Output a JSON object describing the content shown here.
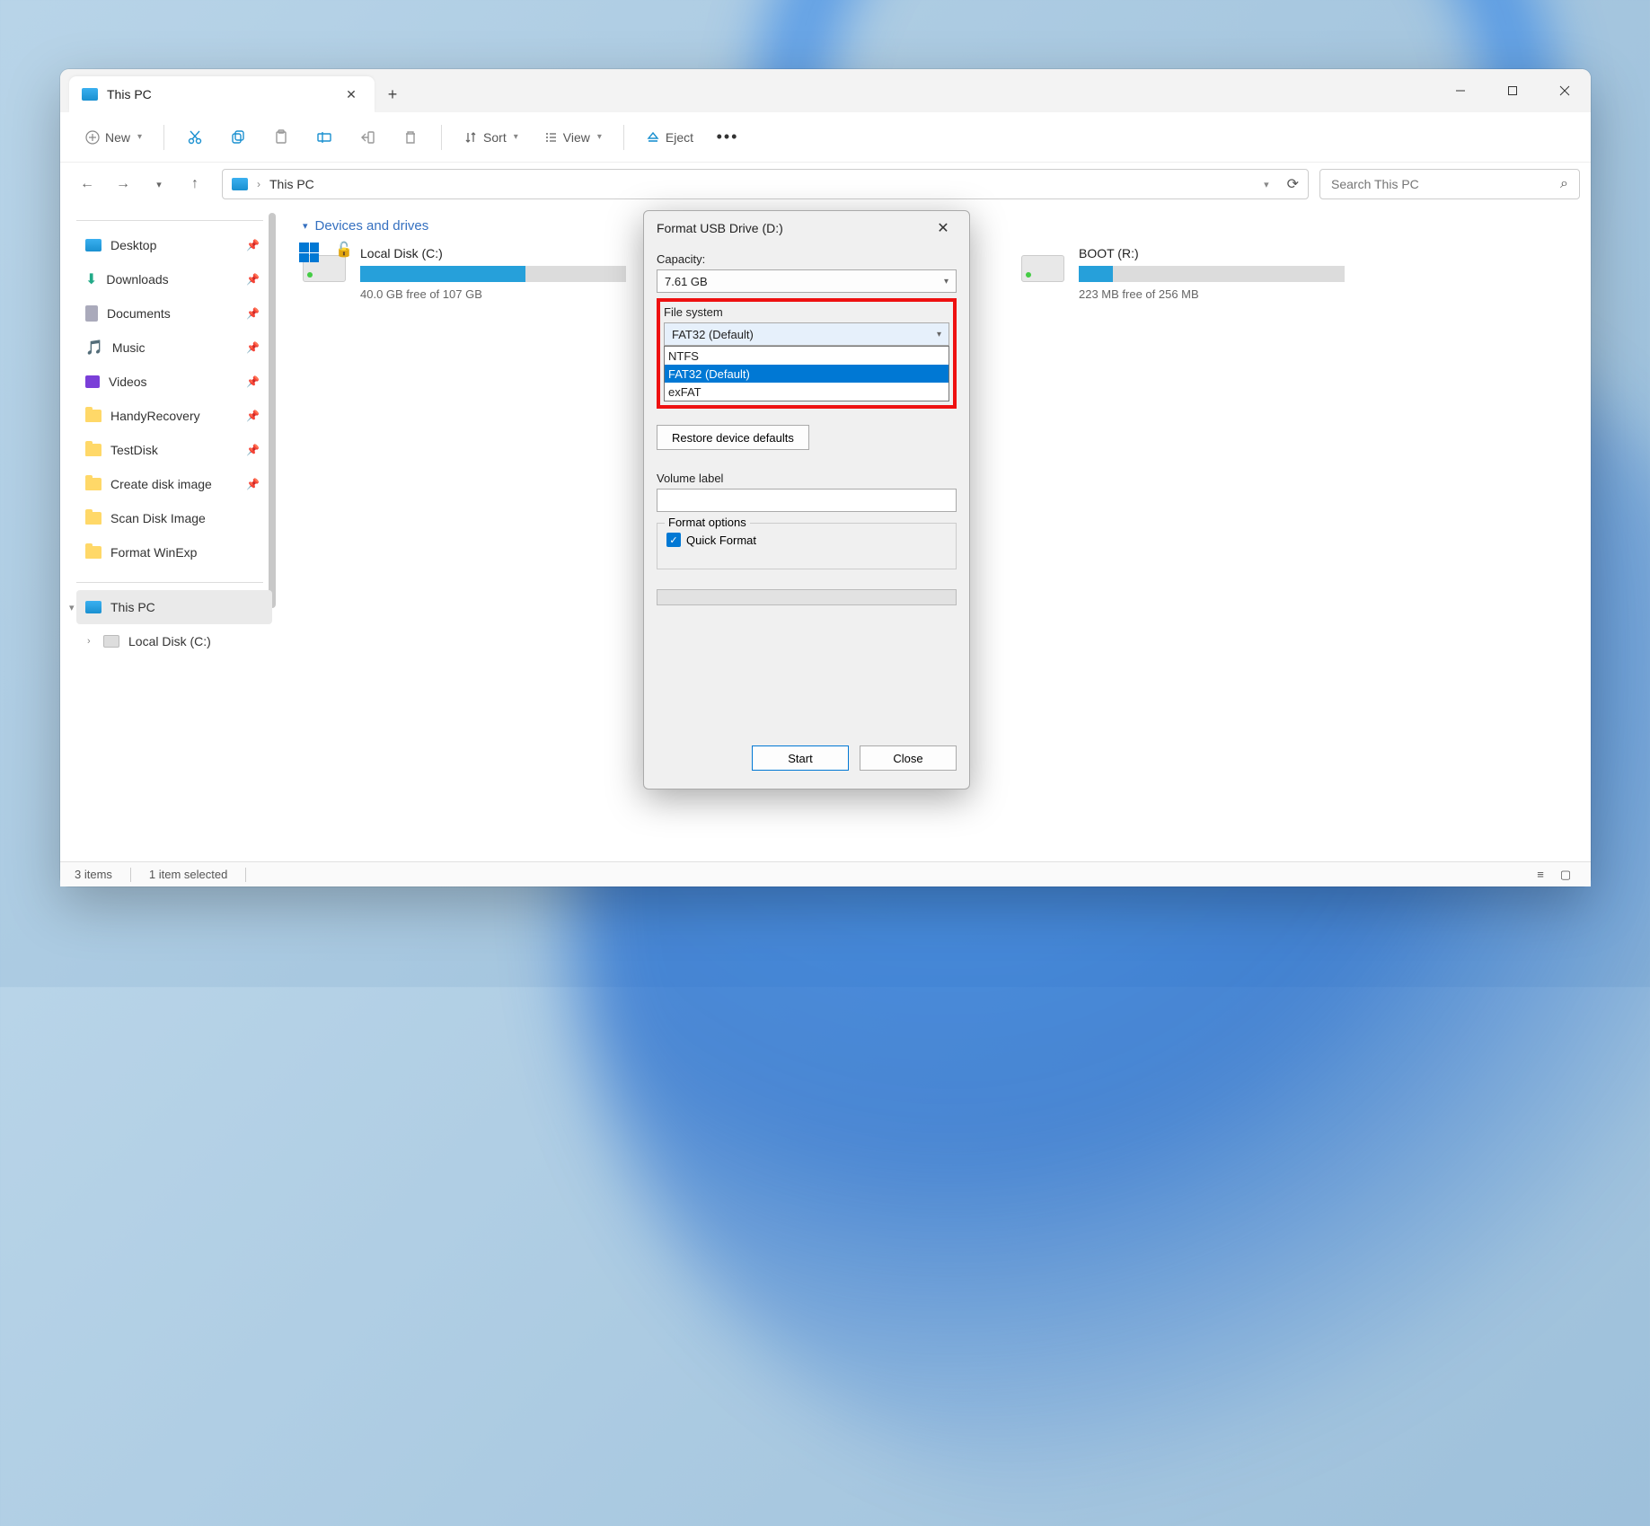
{
  "tab": {
    "title": "This PC"
  },
  "toolbar": {
    "new": "New",
    "sort": "Sort",
    "view": "View",
    "eject": "Eject"
  },
  "address": {
    "path": "This PC"
  },
  "search": {
    "placeholder": "Search This PC"
  },
  "section": {
    "title": "Devices and drives"
  },
  "sidebar": {
    "items": [
      {
        "label": "Desktop"
      },
      {
        "label": "Downloads"
      },
      {
        "label": "Documents"
      },
      {
        "label": "Music"
      },
      {
        "label": "Videos"
      },
      {
        "label": "HandyRecovery"
      },
      {
        "label": "TestDisk"
      },
      {
        "label": "Create disk image"
      },
      {
        "label": "Scan Disk Image"
      },
      {
        "label": "Format WinExp"
      }
    ],
    "thispc": "This PC",
    "localdisk": "Local Disk (C:)"
  },
  "drives": {
    "c": {
      "name": "Local Disk (C:)",
      "sub": "40.0 GB free of 107 GB",
      "fill": 62
    },
    "r": {
      "name": "BOOT (R:)",
      "sub": "223 MB free of 256 MB",
      "fill": 13
    }
  },
  "status": {
    "items": "3 items",
    "selected": "1 item selected"
  },
  "dialog": {
    "title": "Format USB Drive (D:)",
    "capacity_label": "Capacity:",
    "capacity_value": "7.61 GB",
    "fs_label": "File system",
    "fs_value": "FAT32 (Default)",
    "fs_options": [
      "NTFS",
      "FAT32 (Default)",
      "exFAT"
    ],
    "restore": "Restore device defaults",
    "volume_label": "Volume label",
    "volume_value": "",
    "format_options": "Format options",
    "quick_format": "Quick Format",
    "start": "Start",
    "close": "Close"
  }
}
